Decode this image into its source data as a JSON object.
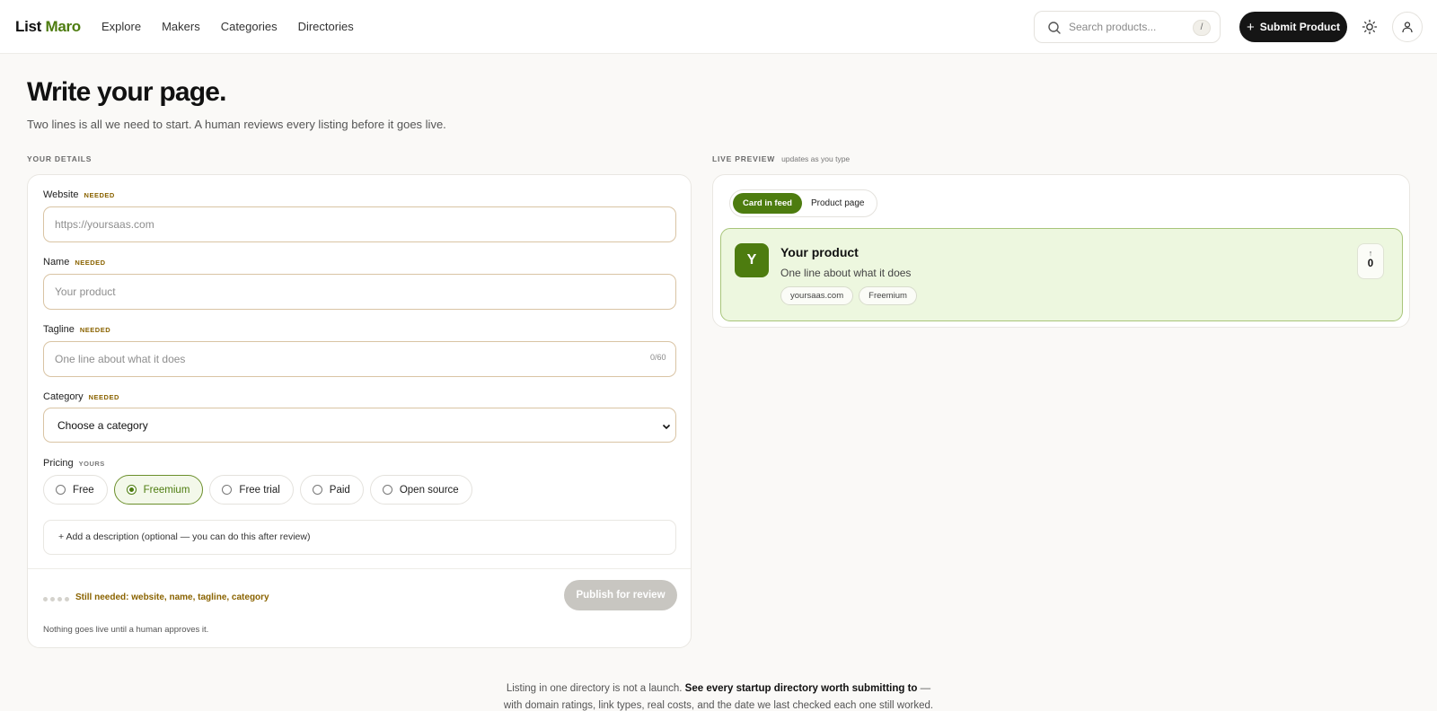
{
  "brand": {
    "part1": "List",
    "part2": "Maro"
  },
  "nav": [
    "Explore",
    "Makers",
    "Categories",
    "Directories"
  ],
  "search": {
    "placeholder": "Search products...",
    "shortcut": "/"
  },
  "header": {
    "submit_label": "Submit Product"
  },
  "page": {
    "title": "Write your page.",
    "subtitle": "Two lines is all we need to start. A human reviews every listing before it goes live."
  },
  "form": {
    "section_label": "YOUR DETAILS",
    "needed_badge": "NEEDED",
    "yours_badge": "YOURS",
    "website": {
      "label": "Website",
      "placeholder": "https://yoursaas.com"
    },
    "name": {
      "label": "Name",
      "placeholder": "Your product"
    },
    "tagline": {
      "label": "Tagline",
      "placeholder": "One line about what it does",
      "counter": "0/60"
    },
    "category": {
      "label": "Category",
      "selected": "Choose a category"
    },
    "pricing": {
      "label": "Pricing",
      "options": [
        "Free",
        "Freemium",
        "Free trial",
        "Paid",
        "Open source"
      ],
      "selected": "Freemium"
    },
    "add_description": "+  Add a description (optional — you can do this after review)",
    "still_needed": "Still needed: website, name, tagline, category",
    "publish_label": "Publish for review",
    "nothing_live": "Nothing goes live until a human approves it."
  },
  "preview": {
    "section_label": "LIVE PREVIEW",
    "hint": "updates as you type",
    "toggle": {
      "on": "Card in feed",
      "off": "Product page"
    },
    "card": {
      "avatar_letter": "Y",
      "name": "Your product",
      "tagline": "One line about what it does",
      "chips": [
        "yoursaas.com",
        "Freemium"
      ],
      "upvote_arrow": "↑",
      "upvotes": "0"
    }
  },
  "footer": {
    "line1_a": "Listing in one directory is not a launch.",
    "line1_b": "See every startup directory worth submitting to",
    "line1_c": " —",
    "line2": "with domain ratings, link types, real costs, and the date we last checked each one still worked."
  },
  "colors": {
    "accent": "#4d7c0f",
    "needed": "#8a6300",
    "preview_bg": "#edf7df"
  }
}
